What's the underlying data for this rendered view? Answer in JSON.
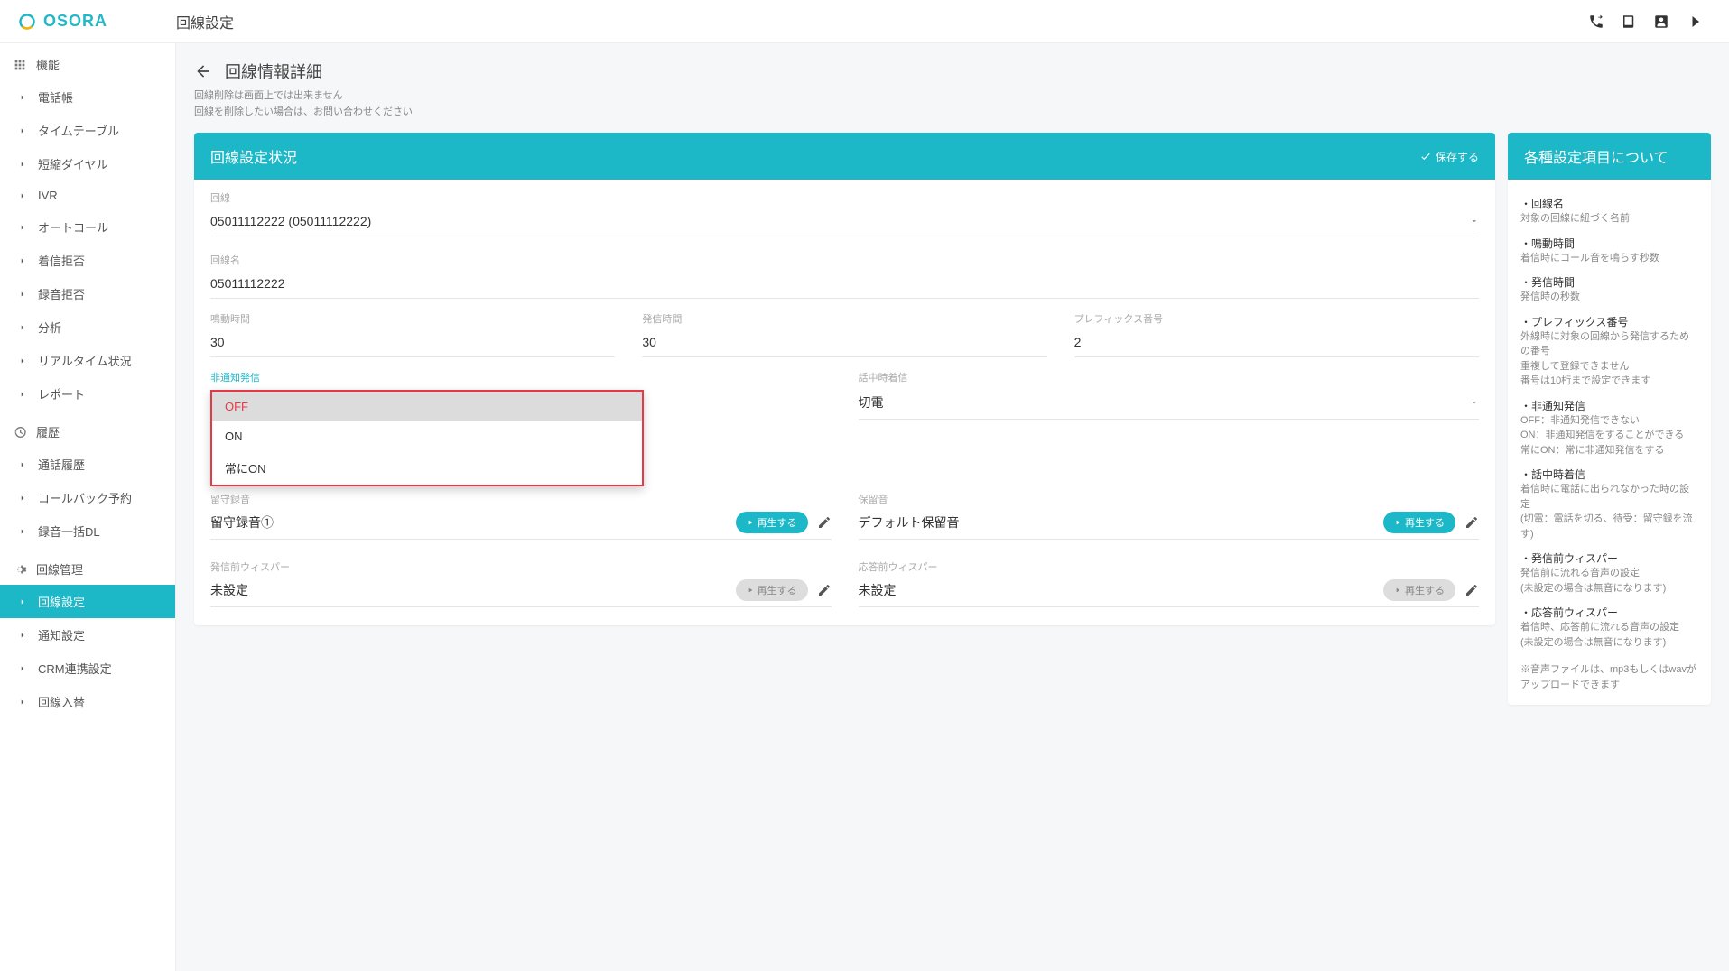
{
  "logo": "OSORA",
  "header": {
    "title": "回線設定"
  },
  "sidebar": {
    "groups": [
      {
        "head": "機能",
        "head_icon": "grid-icon",
        "items": [
          "電話帳",
          "タイムテーブル",
          "短縮ダイヤル",
          "IVR",
          "オートコール",
          "着信拒否",
          "録音拒否",
          "分析",
          "リアルタイム状況",
          "レポート"
        ]
      },
      {
        "head": "履歴",
        "head_icon": "history-icon",
        "items": [
          "通話履歴",
          "コールバック予約",
          "録音一括DL"
        ]
      },
      {
        "head": "回線管理",
        "head_icon": "gear-icon",
        "items": [
          "回線設定",
          "通知設定",
          "CRM連携設定",
          "回線入替"
        ],
        "active_index": 0
      }
    ]
  },
  "page": {
    "title": "回線情報詳細",
    "note1": "回線削除は画面上では出来ません",
    "note2": "回線を削除したい場合は、お問い合わせください"
  },
  "card": {
    "title": "回線設定状況",
    "save": "保存する",
    "fields": {
      "line_label": "回線",
      "line_value": "05011112222 (05011112222)",
      "name_label": "回線名",
      "name_value": "05011112222",
      "ring_label": "鳴動時間",
      "ring_value": "30",
      "call_label": "発信時間",
      "call_value": "30",
      "prefix_label": "プレフィックス番号",
      "prefix_value": "2",
      "anon_label": "非通知発信",
      "busy_label": "話中時着信",
      "busy_value": "切電",
      "vm_label": "留守録音",
      "vm_value": "留守録音①",
      "hold_label": "保留音",
      "hold_value": "デフォルト保留音",
      "prewhisper_label": "発信前ウィスパー",
      "prewhisper_value": "未設定",
      "answhisper_label": "応答前ウィスパー",
      "answhisper_value": "未設定",
      "play": "再生する"
    },
    "anon_options": [
      "OFF",
      "ON",
      "常にON"
    ]
  },
  "help": {
    "title": "各種設定項目について",
    "items": [
      {
        "t": "・回線名",
        "d": "対象の回線に紐づく名前"
      },
      {
        "t": "・鳴動時間",
        "d": "着信時にコール音を鳴らす秒数"
      },
      {
        "t": "・発信時間",
        "d": "発信時の秒数"
      },
      {
        "t": "・プレフィックス番号",
        "d": "外線時に対象の回線から発信するための番号\n重複して登録できません\n番号は10桁まで設定できます"
      },
      {
        "t": "・非通知発信",
        "d": "OFF：非通知発信できない\nON：非通知発信をすることができる\n常にON：常に非通知発信をする"
      },
      {
        "t": "・話中時着信",
        "d": "着信時に電話に出られなかった時の設定\n(切電：電話を切る、待受：留守録を流す)"
      },
      {
        "t": "・発信前ウィスパー",
        "d": "発信前に流れる音声の設定\n(未設定の場合は無音になります)"
      },
      {
        "t": "・応答前ウィスパー",
        "d": "着信時、応答前に流れる音声の設定\n(未設定の場合は無音になります)"
      }
    ],
    "note": "※音声ファイルは、mp3もしくはwavがアップロードできます"
  }
}
